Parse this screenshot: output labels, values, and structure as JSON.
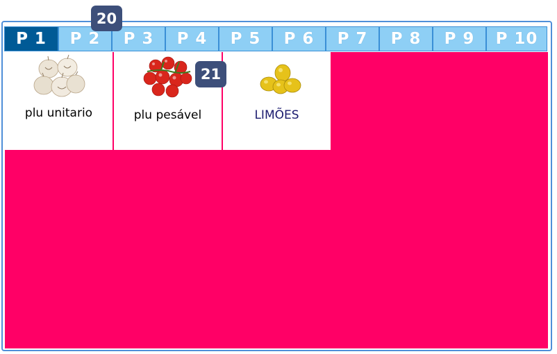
{
  "tabs": [
    "P 1",
    "P 2",
    "P 3",
    "P 4",
    "P 5",
    "P 6",
    "P 7",
    "P 8",
    "P 9",
    "P 10"
  ],
  "active_tab": "P 1",
  "products": [
    {
      "label": "plu unitario",
      "image": "garlic-image",
      "label_color": "#1a1a6e"
    },
    {
      "label": "plu pesável",
      "image": "tomatoes-image",
      "label_color": "#000000"
    },
    {
      "label": "LIMÕES",
      "image": "lemons-image",
      "label_color": "#1a1a6e"
    }
  ],
  "badges": [
    "20",
    "21"
  ],
  "colors": {
    "panel": "#ff0066",
    "tab": "#8ecff5",
    "tab_active": "#005a96",
    "badge": "#3d4f7a"
  }
}
